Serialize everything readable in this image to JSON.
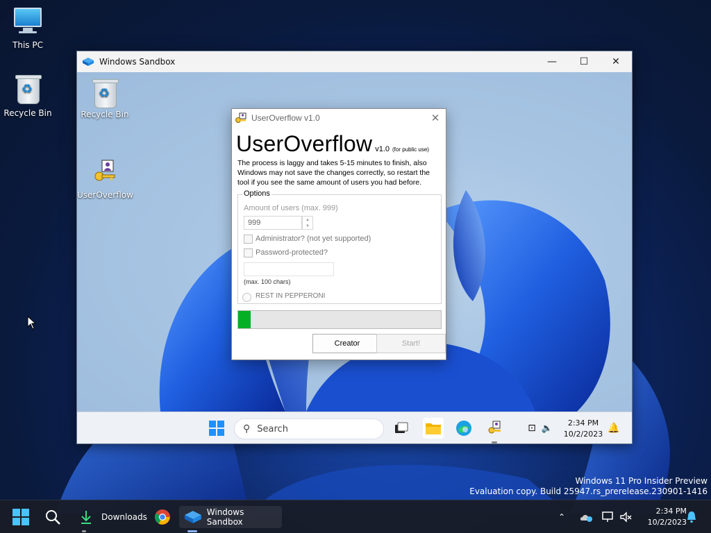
{
  "host_desktop": {
    "icons": [
      {
        "label": "This PC",
        "icon": "monitor-icon"
      },
      {
        "label": "Recycle Bin",
        "icon": "recycle-bin-icon"
      }
    ],
    "watermark_line1": "Windows 11 Pro Insider Preview",
    "watermark_line2": "Evaluation copy. Build 25947.rs_prerelease.230901-1416"
  },
  "sandbox_window": {
    "title": "Windows Sandbox",
    "icons": [
      {
        "label": "Recycle Bin",
        "icon": "recycle-bin-icon"
      },
      {
        "label": "UserOverflow",
        "icon": "key-user-icon"
      }
    ],
    "taskbar": {
      "search_placeholder": "Search",
      "time": "2:34 PM",
      "date": "10/2/2023"
    }
  },
  "dialog": {
    "window_title": "UserOverflow v1.0",
    "heading": "UserOverflow",
    "version": "v1.0",
    "version_note": "(for public use)",
    "description": "The process is laggy and takes 5-15 minutes to finish, also Windows may not save the changes correctly, so restart the tool if you see the same amount of users you had before.",
    "options_legend": "Options",
    "amount_label": "Amount of users (max. 999)",
    "amount_value": "999",
    "admin_label": "Administrator? (not yet supported)",
    "password_label": "Password-protected?",
    "password_value": "",
    "password_hint": "(max. 100 chars)",
    "radio_label": "REST IN PEPPERONI",
    "progress": 0.06,
    "creator_button": "Creator",
    "start_button": "Start!"
  },
  "taskbar": {
    "downloads_label": "Downloads",
    "sandbox_label": "Windows Sandbox",
    "time": "2:34 PM",
    "date": "10/2/2023"
  },
  "colors": {
    "accent": "#0078d4",
    "progress_fill": "#06b025"
  }
}
